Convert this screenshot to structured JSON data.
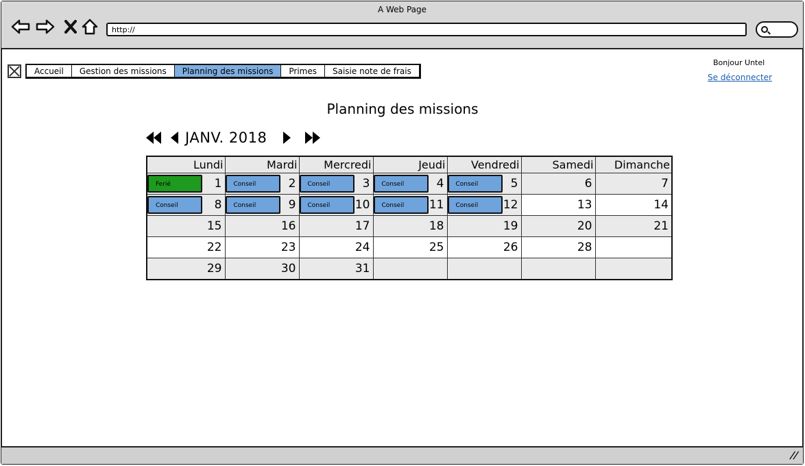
{
  "browser": {
    "window_title": "A Web Page",
    "url": "http://"
  },
  "nav": {
    "tabs": [
      {
        "label": "Accueil",
        "active": false
      },
      {
        "label": "Gestion des missions",
        "active": false
      },
      {
        "label": "Planning des missions",
        "active": true
      },
      {
        "label": "Primes",
        "active": false
      },
      {
        "label": "Saisie note de frais",
        "active": false
      }
    ]
  },
  "user": {
    "greeting": "Bonjour Untel",
    "logout_label": "Se déconnecter"
  },
  "page": {
    "title": "Planning des missions"
  },
  "calendar": {
    "month_label": "JANV. 2018",
    "weekdays": [
      "Lundi",
      "Mardi",
      "Mercredi",
      "Jeudi",
      "Vendredi",
      "Samedi",
      "Dimanche"
    ],
    "weeks": [
      [
        {
          "day": "1",
          "event": "Ferié",
          "event_type": "holiday"
        },
        {
          "day": "2",
          "event": "Conseil",
          "event_type": "mission"
        },
        {
          "day": "3",
          "event": "Conseil",
          "event_type": "mission"
        },
        {
          "day": "4",
          "event": "Conseil",
          "event_type": "mission"
        },
        {
          "day": "5",
          "event": "Conseil",
          "event_type": "mission"
        },
        {
          "day": "6"
        },
        {
          "day": "7"
        }
      ],
      [
        {
          "day": "8",
          "event": "Conseil",
          "event_type": "mission"
        },
        {
          "day": "9",
          "event": "Conseil",
          "event_type": "mission"
        },
        {
          "day": "10",
          "event": "Conseil",
          "event_type": "mission"
        },
        {
          "day": "11",
          "event": "Conseil",
          "event_type": "mission"
        },
        {
          "day": "12",
          "event": "Conseil",
          "event_type": "mission"
        },
        {
          "day": "13"
        },
        {
          "day": "14"
        }
      ],
      [
        {
          "day": "15"
        },
        {
          "day": "16"
        },
        {
          "day": "17"
        },
        {
          "day": "18"
        },
        {
          "day": "19"
        },
        {
          "day": "20"
        },
        {
          "day": "21"
        }
      ],
      [
        {
          "day": "22"
        },
        {
          "day": "23"
        },
        {
          "day": "24"
        },
        {
          "day": "25"
        },
        {
          "day": "26"
        },
        {
          "day": "28"
        },
        {
          "day": ""
        }
      ],
      [
        {
          "day": "29"
        },
        {
          "day": "30"
        },
        {
          "day": "31"
        },
        {
          "day": ""
        },
        {
          "day": ""
        },
        {
          "day": ""
        },
        {
          "day": ""
        }
      ]
    ],
    "colors": {
      "mission": "#6fa3dc",
      "holiday": "#1e9a1e",
      "active_tab": "#7faee0"
    }
  }
}
